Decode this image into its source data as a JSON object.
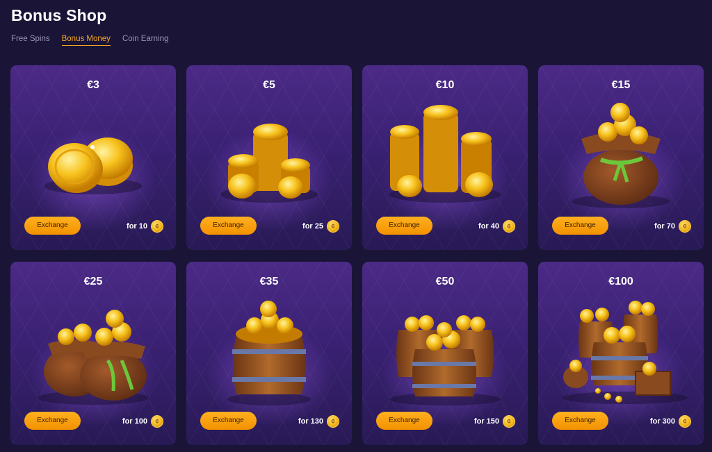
{
  "page": {
    "title": "Bonus Shop"
  },
  "tabs": [
    {
      "label": "Free Spins",
      "active": false
    },
    {
      "label": "Bonus Money",
      "active": true
    },
    {
      "label": "Coin Earning",
      "active": false
    }
  ],
  "colors": {
    "background": "#1a1537",
    "accent": "#f5a623",
    "card": "#3a2173"
  },
  "cards": [
    {
      "price": "€3",
      "button": "Exchange",
      "cost": "for 10",
      "art": "coins-small-pile-icon"
    },
    {
      "price": "€5",
      "button": "Exchange",
      "cost": "for 25",
      "art": "coin-stacks-icon"
    },
    {
      "price": "€10",
      "button": "Exchange",
      "cost": "for 40",
      "art": "coin-towers-icon"
    },
    {
      "price": "€15",
      "button": "Exchange",
      "cost": "for 70",
      "art": "coin-sack-icon"
    },
    {
      "price": "€25",
      "button": "Exchange",
      "cost": "for 100",
      "art": "two-coin-sacks-icon"
    },
    {
      "price": "€35",
      "button": "Exchange",
      "cost": "for 130",
      "art": "coin-barrel-icon"
    },
    {
      "price": "€50",
      "button": "Exchange",
      "cost": "for 150",
      "art": "three-coin-barrels-icon"
    },
    {
      "price": "€100",
      "button": "Exchange",
      "cost": "for 300",
      "art": "treasure-hoard-icon"
    }
  ]
}
